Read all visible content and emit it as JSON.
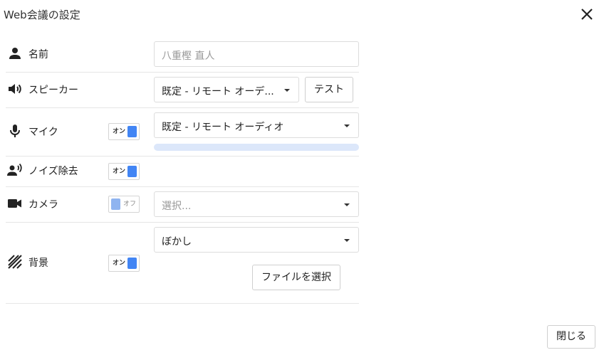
{
  "dialog": {
    "title": "Web会議の設定"
  },
  "name": {
    "label": "名前",
    "placeholder": "八重樫 直人"
  },
  "speaker": {
    "label": "スピーカー",
    "selected": "既定 - リモート オーデ...",
    "test_label": "テスト"
  },
  "mic": {
    "label": "マイク",
    "toggle": "オン",
    "selected": "既定 - リモート オーディオ",
    "level": 0
  },
  "noise": {
    "label": "ノイズ除去",
    "toggle": "オン"
  },
  "camera": {
    "label": "カメラ",
    "toggle": "オフ",
    "placeholder": "選択..."
  },
  "background": {
    "label": "背景",
    "toggle": "オン",
    "selected": "ぼかし",
    "file_button": "ファイルを選択"
  },
  "footer": {
    "close_label": "閉じる"
  },
  "icons": {
    "close": "close-icon",
    "person": "person-icon",
    "speaker": "speaker-icon",
    "mic": "mic-icon",
    "noise": "voice-person-icon",
    "camera": "videocam-icon",
    "background": "stripes-icon"
  },
  "colors": {
    "accent": "#4285f4",
    "accent_light": "#8fb4f0",
    "meter_track": "#dce7fa"
  }
}
